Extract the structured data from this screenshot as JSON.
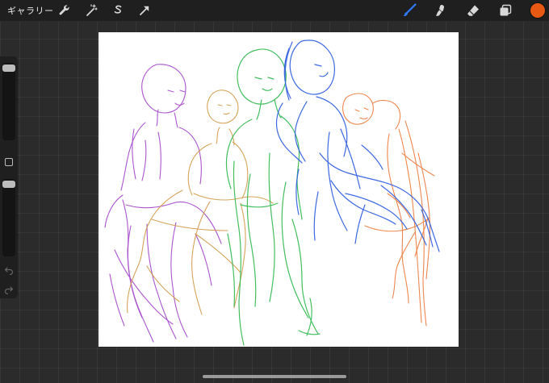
{
  "toolbar": {
    "gallery_label": "ギャラリー",
    "left_icons": [
      "wrench-icon",
      "magic-wand-icon",
      "selection-icon",
      "transform-arrow-icon"
    ],
    "right_icons": [
      "brush-icon",
      "smudge-icon",
      "eraser-icon",
      "layers-icon"
    ],
    "active_tool": "brush",
    "active_tool_color": "#2f7bff",
    "current_color": "#e85a14"
  },
  "sidebar": {
    "brush_size_level": 0.98,
    "opacity_level": 0.98,
    "icons": [
      "square-modify-icon",
      "undo-icon",
      "redo-icon"
    ]
  },
  "canvas": {
    "background": "#ffffff",
    "sketch_colors": {
      "purple": "#a243c8",
      "orange_brown": "#d19a4a",
      "green": "#2fb84e",
      "blue": "#2d5de0",
      "orange": "#ec7a3c"
    }
  }
}
